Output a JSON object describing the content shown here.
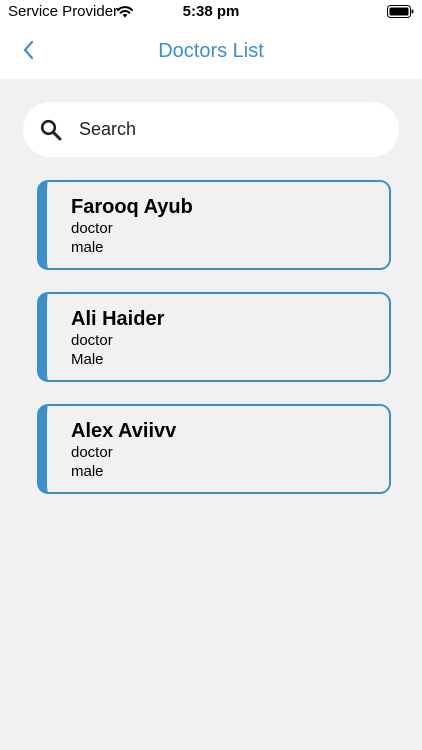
{
  "status_bar": {
    "carrier": "Service Provider",
    "time": "5:38 pm"
  },
  "nav": {
    "title": "Doctors List"
  },
  "search": {
    "placeholder": "Search"
  },
  "doctors": [
    {
      "name": "Farooq Ayub",
      "role": "doctor",
      "gender": "male"
    },
    {
      "name": "Ali Haider",
      "role": "doctor",
      "gender": "Male"
    },
    {
      "name": "Alex Aviivv",
      "role": "doctor",
      "gender": "male"
    }
  ],
  "colors": {
    "accent": "#3d8ec9",
    "background": "#f1f1f1",
    "surface": "#ffffff"
  }
}
